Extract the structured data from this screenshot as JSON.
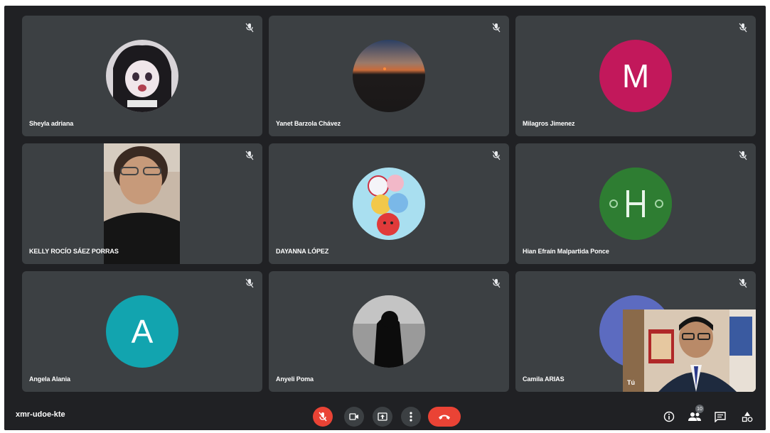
{
  "meeting": {
    "code": "xmr-udoe-kte",
    "participant_count": "10"
  },
  "participants": [
    {
      "name": "Sheyla adriana",
      "type": "photo-avatar"
    },
    {
      "name": "Yanet Barzola Chávez",
      "type": "photo-avatar"
    },
    {
      "name": "Milagros Jimenez",
      "type": "initial-avatar",
      "initial": "M",
      "color": "#c2185b"
    },
    {
      "name": "KELLY ROCÍO SÁEZ PORRAS",
      "type": "video"
    },
    {
      "name": "DAYANNA LÓPEZ",
      "type": "photo-avatar"
    },
    {
      "name": "Hian Efraín Malpartida Ponce",
      "type": "photo-avatar",
      "color": "#2e7d32"
    },
    {
      "name": "Angela Alania",
      "type": "initial-avatar",
      "initial": "A",
      "color": "#12a4af"
    },
    {
      "name": "Anyeli Poma",
      "type": "photo-avatar"
    },
    {
      "name": "Camila ARIAS",
      "type": "photo-avatar",
      "color": "#5c6bc0"
    }
  ],
  "self_view": {
    "label": "Tú"
  },
  "controls": {
    "mic": {
      "state": "muted",
      "color": "#ea4335"
    },
    "camera": {
      "state": "on"
    },
    "present": {
      "icon": "present-icon"
    },
    "more": {
      "icon": "more-vert-icon"
    },
    "leave": {
      "color": "#ea4335"
    }
  },
  "right_controls": [
    "info-icon",
    "people-icon",
    "chat-icon",
    "activities-icon"
  ]
}
